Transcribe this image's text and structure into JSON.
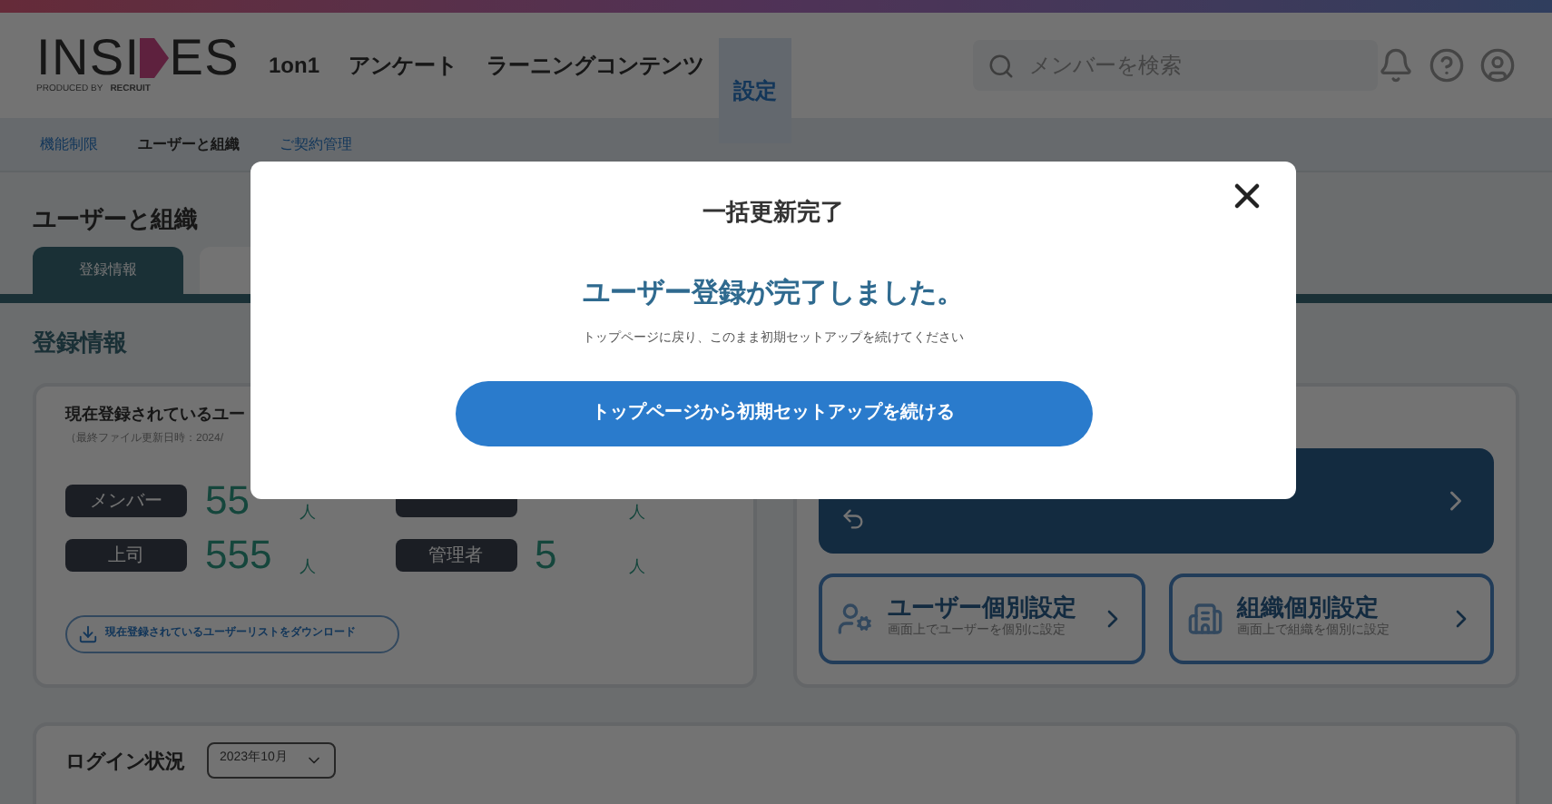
{
  "header": {
    "logo": {
      "left": "INSI",
      "right": "ES",
      "tagline": "PRODUCED BY",
      "brand": "RECRUIT"
    },
    "nav": [
      {
        "label": "1on1",
        "selected": false
      },
      {
        "label": "アンケート",
        "selected": false
      },
      {
        "label": "ラーニングコンテンツ",
        "selected": false
      },
      {
        "label": "設定",
        "selected": true
      }
    ],
    "search": {
      "placeholder": "メンバーを検索"
    }
  },
  "subnav": [
    {
      "label": "機能制限",
      "selected": false
    },
    {
      "label": "ユーザーと組織",
      "selected": true
    },
    {
      "label": "ご契約管理",
      "selected": false
    }
  ],
  "page_title": "ユーザーと組織",
  "tabs": [
    {
      "label": "登録情報",
      "selected": true
    }
  ],
  "section_title": "登録情報",
  "stats_card": {
    "title": "現在登録されているユー",
    "updated": "（最終ファイル更新日時：2024/",
    "stats": [
      {
        "label": "メンバー",
        "value": "55",
        "unit": "人"
      },
      {
        "unit": "人"
      },
      {
        "label": "上司",
        "value": "555",
        "unit": "人"
      },
      {
        "label": "管理者",
        "value": "5",
        "unit": "人"
      }
    ],
    "download": "現在登録されているユーザーリストをダウンロード"
  },
  "actions": [
    {
      "kind": "user",
      "title": "ユーザー個別設定",
      "subtitle": "画面上でユーザーを個別に設定"
    },
    {
      "kind": "org",
      "title": "組織個別設定",
      "subtitle": "画面上で組織を個別に設定"
    }
  ],
  "login": {
    "title": "ログイン状況",
    "month": "2023年10月"
  },
  "modal": {
    "title": "一括更新完了",
    "heading": "ユーザー登録が完了しました。",
    "message": "トップページに戻り、このまま初期セットアップを続けてください",
    "button": "トップページから初期セットアップを続ける"
  }
}
